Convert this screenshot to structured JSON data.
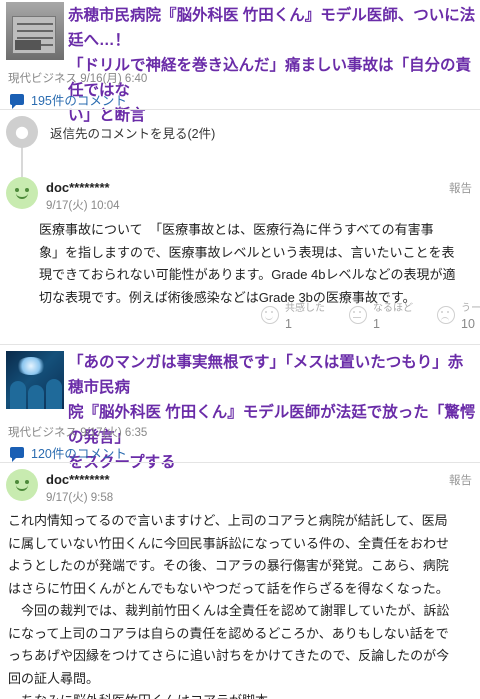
{
  "article1": {
    "headline_lines": [
      "赤穂市民病院『脳外科医 竹田くん』モデル医師、ついに法廷へ…！",
      "「ドリルで神経を巻き込んだ」痛ましい事故は「自分の責任ではな",
      "い」と断言"
    ],
    "source": "現代ビジネス 9/16(月) 6:40",
    "comments_link": "195件のコメント"
  },
  "reply_toggle": {
    "label": "返信先のコメントを見る(2件)"
  },
  "comment1": {
    "user": "doc********",
    "date": "9/17(火) 10:04",
    "report": "報告",
    "body_lines": [
      "医療事故について　「医療事故とは、医療行為に伴うすべての有害事",
      "象」を指しますので、医療事故レベルという表現は、言いたいことを表",
      "現できておられない可能性があります。Grade 4bレベルなどの表現が適",
      "切な表現です。例えば術後感染などはGrade 3bの医療事故です。"
    ],
    "reactions": [
      {
        "label": "共感した",
        "count": "1",
        "icon": "smile-icon"
      },
      {
        "label": "なるほど",
        "count": "1",
        "icon": "neutral-icon"
      },
      {
        "label": "うーん",
        "count": "10",
        "icon": "hmm-icon"
      }
    ]
  },
  "article2": {
    "headline_lines": [
      "「あのマンガは事実無根です」「メスは置いたつもり」赤穂市民病",
      "院『脳外科医 竹田くん』モデル医師が法廷で放った「驚愕の発言」",
      "をスクープする"
    ],
    "source": "現代ビジネス 9/17(火) 6:35",
    "comments_link": "120件のコメント"
  },
  "comment2": {
    "user": "doc********",
    "date": "9/17(火) 9:58",
    "report": "報告",
    "body_lines": [
      "これ内情知ってるので言いますけど、上司のコアラと病院が結託して、医局",
      "に属していない竹田くんに今回民事訴訟になっている件の、全責任をおわせ",
      "ようとしたのが発端です。その後、コアラの暴行傷害が発覚。こあら、病院",
      "はさらに竹田くんがとんでもないやつだって話を作らざるを得なくなった。",
      "　今回の裁判では、裁判前竹田くんは全責任を認めて謝罪していたが、訴訟",
      "になって上司のコアラは自らの責任を認めるどころか、ありもしない話をで",
      "っちあげや因縁をつけてさらに追い討ちをかけてきたので、反論したのが今",
      "回の証人尋問。",
      "　ちなみに脳外科医竹田くんはコアラが脚本。"
    ]
  }
}
